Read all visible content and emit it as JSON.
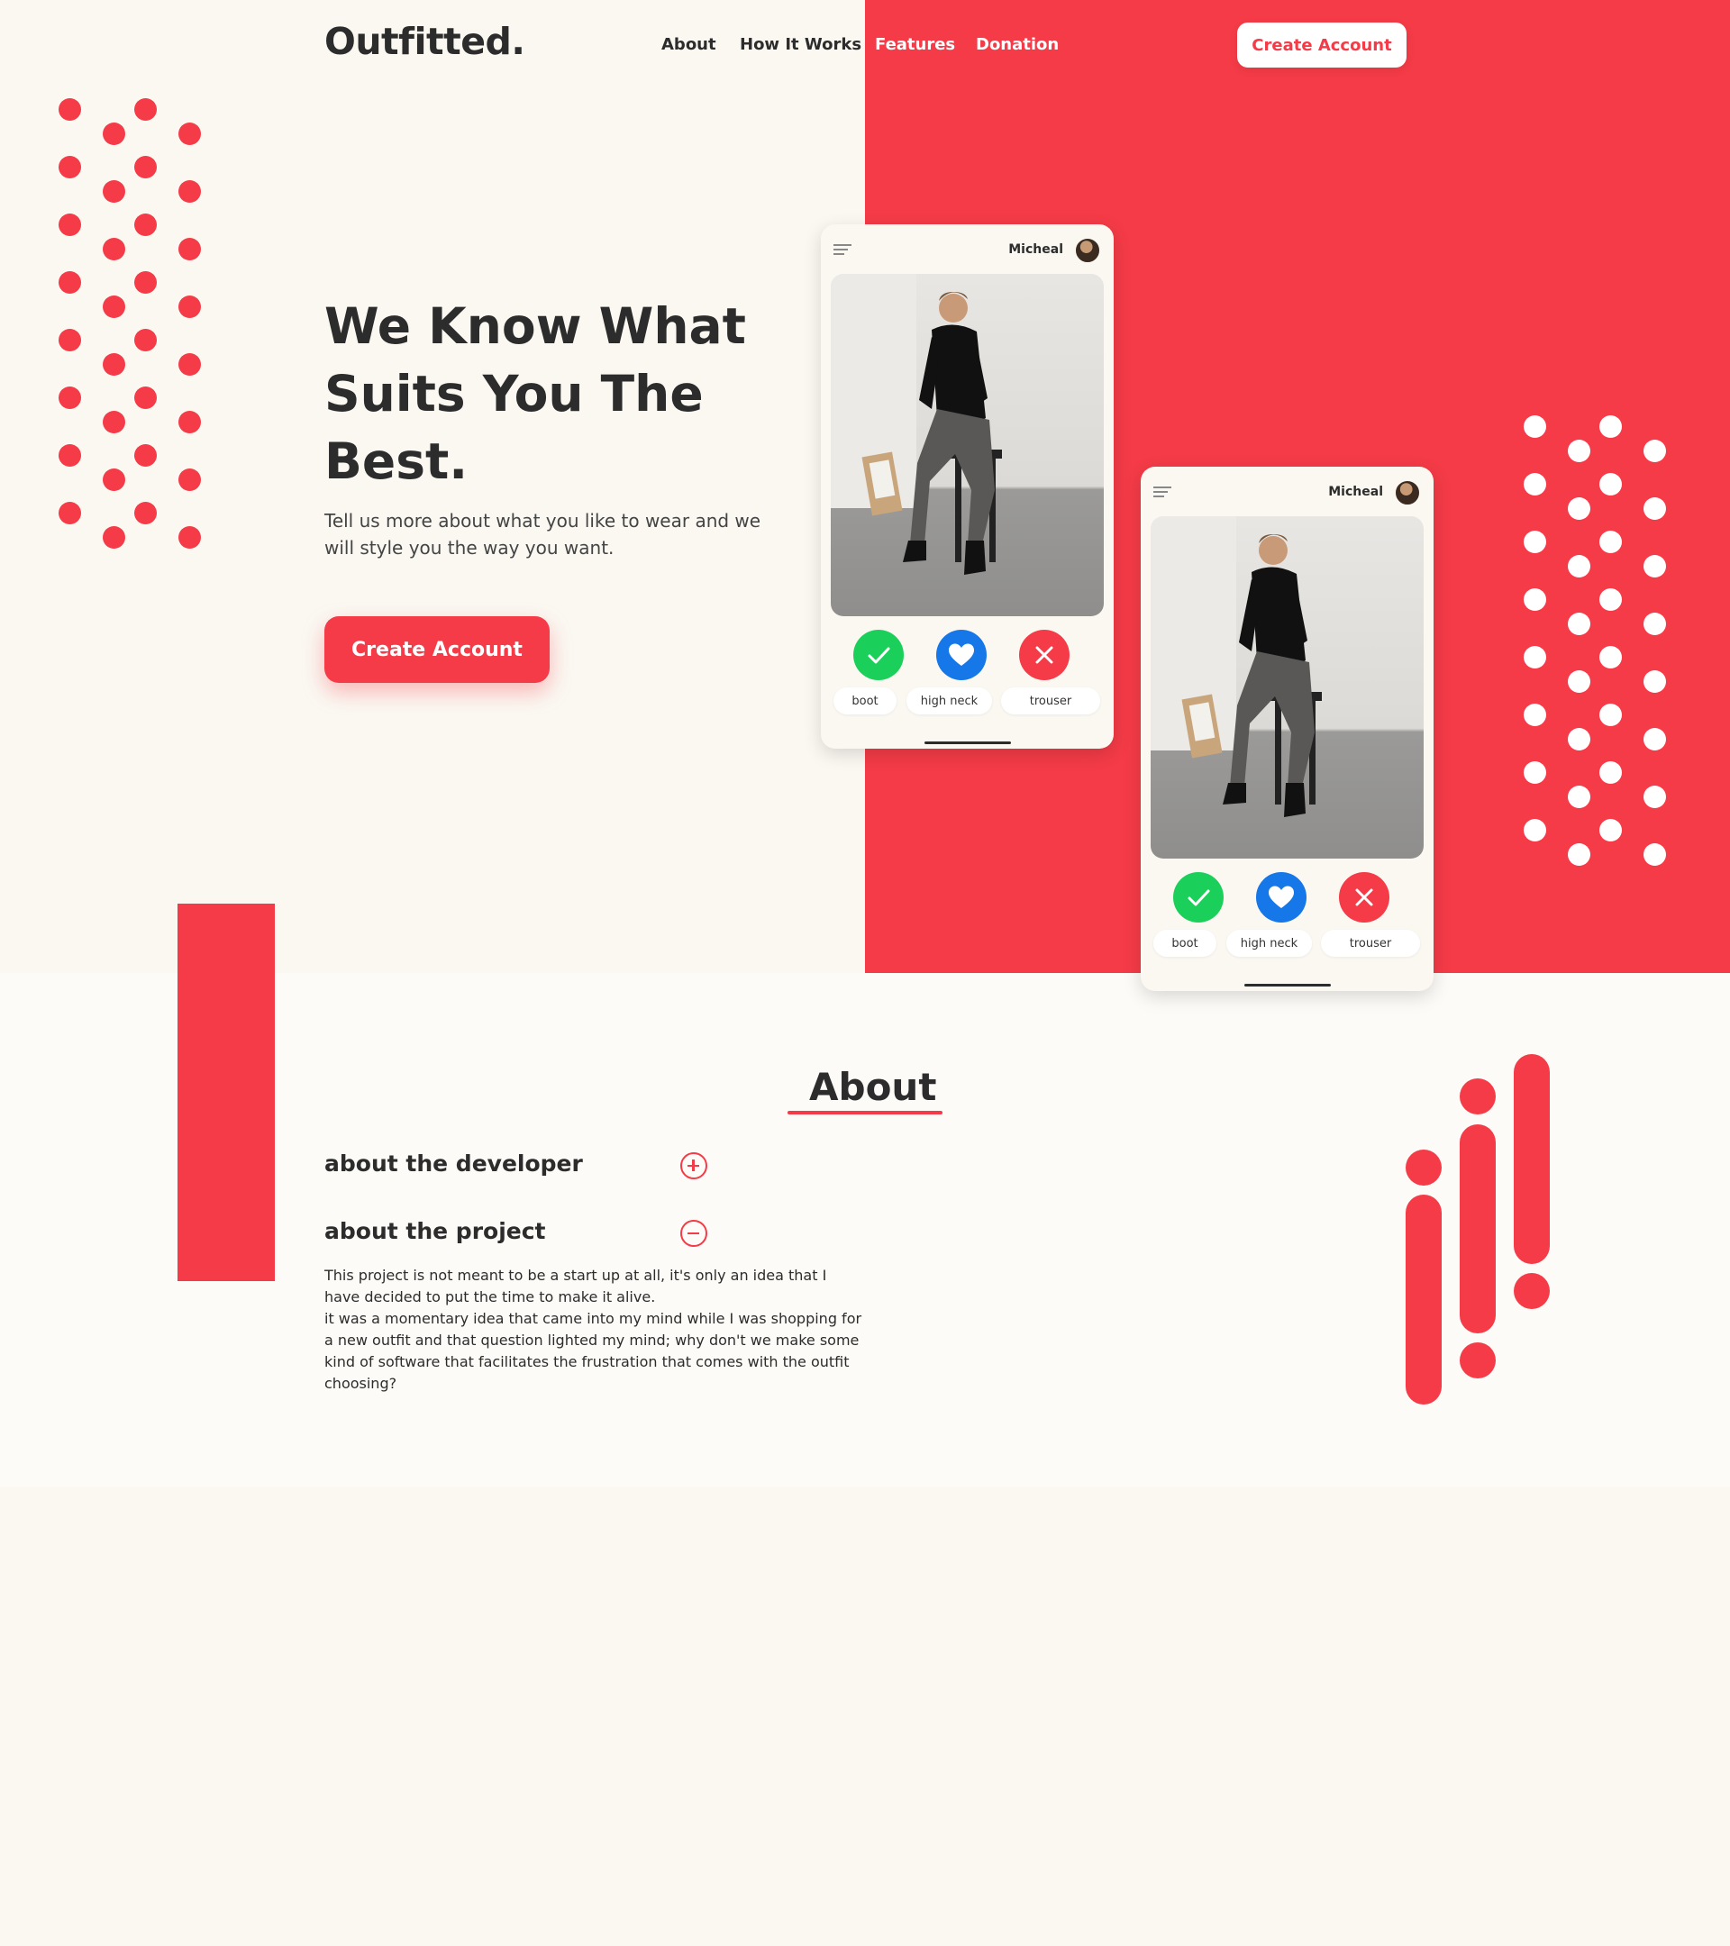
{
  "brand": {
    "logo": "Outfitted."
  },
  "nav": [
    {
      "label": "About"
    },
    {
      "label": "How It Works"
    },
    {
      "label": "Features"
    },
    {
      "label": "Donation"
    }
  ],
  "header": {
    "cta_label": "Create Account"
  },
  "hero": {
    "title": "We Know What Suits You The Best.",
    "subtitle": "Tell us more about what you like to wear and we will style you the way you want.",
    "cta_label": "Create Account"
  },
  "cards": [
    {
      "user_name": "Micheal",
      "tags": [
        "boot",
        "high neck",
        "trouser"
      ]
    },
    {
      "user_name": "Micheal",
      "tags": [
        "boot",
        "high neck",
        "trouser"
      ]
    }
  ],
  "card_actions": {
    "like": "check-icon",
    "favorite": "heart-icon",
    "dislike": "close-icon"
  },
  "about": {
    "title": "About",
    "items": [
      {
        "label": "about the developer",
        "state": "collapsed",
        "icon": "plus-circle-icon"
      },
      {
        "label": "about the project",
        "state": "expanded",
        "icon": "minus-circle-icon",
        "body": "This project is not meant to be a start up at all, it's only an idea that I have decided to put the time to make it alive.\nit was a momentary idea that came into my mind while I was shopping for a new outfit and that question lighted my mind; why don't we make some kind of software that facilitates the frustration that comes with the outfit choosing?"
      }
    ]
  },
  "colors": {
    "accent": "#f43b47",
    "background": "#fbf8f2",
    "text": "#2c2c2c",
    "like": "#1bd05a",
    "favorite": "#1577e8"
  }
}
